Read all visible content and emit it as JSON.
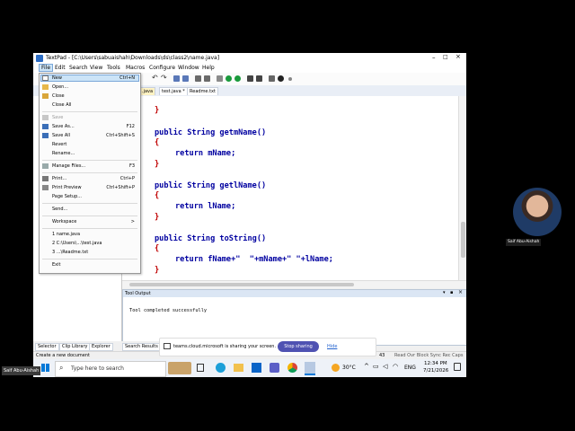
{
  "window": {
    "title": "TextPad - [C:\\Users\\sabuaishah\\Downloads\\ds\\class2\\name.java]"
  },
  "menubar": [
    "File",
    "Edit",
    "Search",
    "View",
    "Tools",
    "Macros",
    "Configure",
    "Window",
    "Help"
  ],
  "tabs": [
    {
      "label": ".java"
    },
    {
      "label": "test.java *"
    },
    {
      "label": "Readme.txt"
    }
  ],
  "file_menu": {
    "items": [
      {
        "label": "New",
        "shortcut": "Ctrl+N"
      },
      {
        "label": "Open...",
        "shortcut": ""
      },
      {
        "label": "Close",
        "shortcut": ""
      },
      {
        "label": "Close All",
        "shortcut": ""
      },
      {
        "label": "Save",
        "shortcut": ""
      },
      {
        "label": "Save As...",
        "shortcut": "F12"
      },
      {
        "label": "Save All",
        "shortcut": "Ctrl+Shift+S"
      },
      {
        "label": "Revert",
        "shortcut": ""
      },
      {
        "label": "Rename...",
        "shortcut": ""
      },
      {
        "label": "Manage Files...",
        "shortcut": "F3"
      },
      {
        "label": "Print...",
        "shortcut": "Ctrl+P"
      },
      {
        "label": "Print Preview",
        "shortcut": "Ctrl+Shift+P"
      },
      {
        "label": "Page Setup...",
        "shortcut": ""
      },
      {
        "label": "Send...",
        "shortcut": ""
      },
      {
        "label": "Workspace",
        "shortcut": ">"
      },
      {
        "label": "1 name.java",
        "shortcut": ""
      },
      {
        "label": "2 C:\\Users\\...\\test.java",
        "shortcut": ""
      },
      {
        "label": "3 ...\\Readme.txt",
        "shortcut": ""
      },
      {
        "label": "Exit",
        "shortcut": ""
      }
    ]
  },
  "code": {
    "line1": "}",
    "line2": "public String getmName()",
    "line3": "{",
    "line4": "return mName;",
    "line5": "}",
    "line6": "public String getlName()",
    "line7": "{",
    "line8": "return lName;",
    "line9": "}",
    "line10": "public String toString()",
    "line11": "{",
    "line12": "return fName+\"  \"+mName+\" \"+lName;",
    "line13": "}"
  },
  "tool_output": {
    "title": "Tool Output",
    "message": "Tool completed successfully"
  },
  "bottom_tabs": [
    "Selector",
    "Clip Library",
    "Explorer",
    "Search Results"
  ],
  "share_bar": {
    "text": "teams.cloud.microsoft is sharing your screen.",
    "stop_label": "Stop sharing",
    "hide_label": "Hide"
  },
  "status": {
    "left": "Create a new document",
    "line": "53",
    "col": "43",
    "flags": "Read  Ovr  Block  Sync  Rec  Caps"
  },
  "taskbar": {
    "search_placeholder": "Type here to search",
    "temp": "30°C",
    "lang": "ENG",
    "time": "12:34 PM",
    "date": "7/21/2026"
  },
  "participants": {
    "right_name": "Saif Abu-Aishah",
    "left_name": "Saif Abu-Aishah"
  },
  "colors": {
    "keyword": "#0000a0",
    "brace": "#c00000",
    "teams_button": "#4f52b2",
    "accent": "#0078d7"
  }
}
